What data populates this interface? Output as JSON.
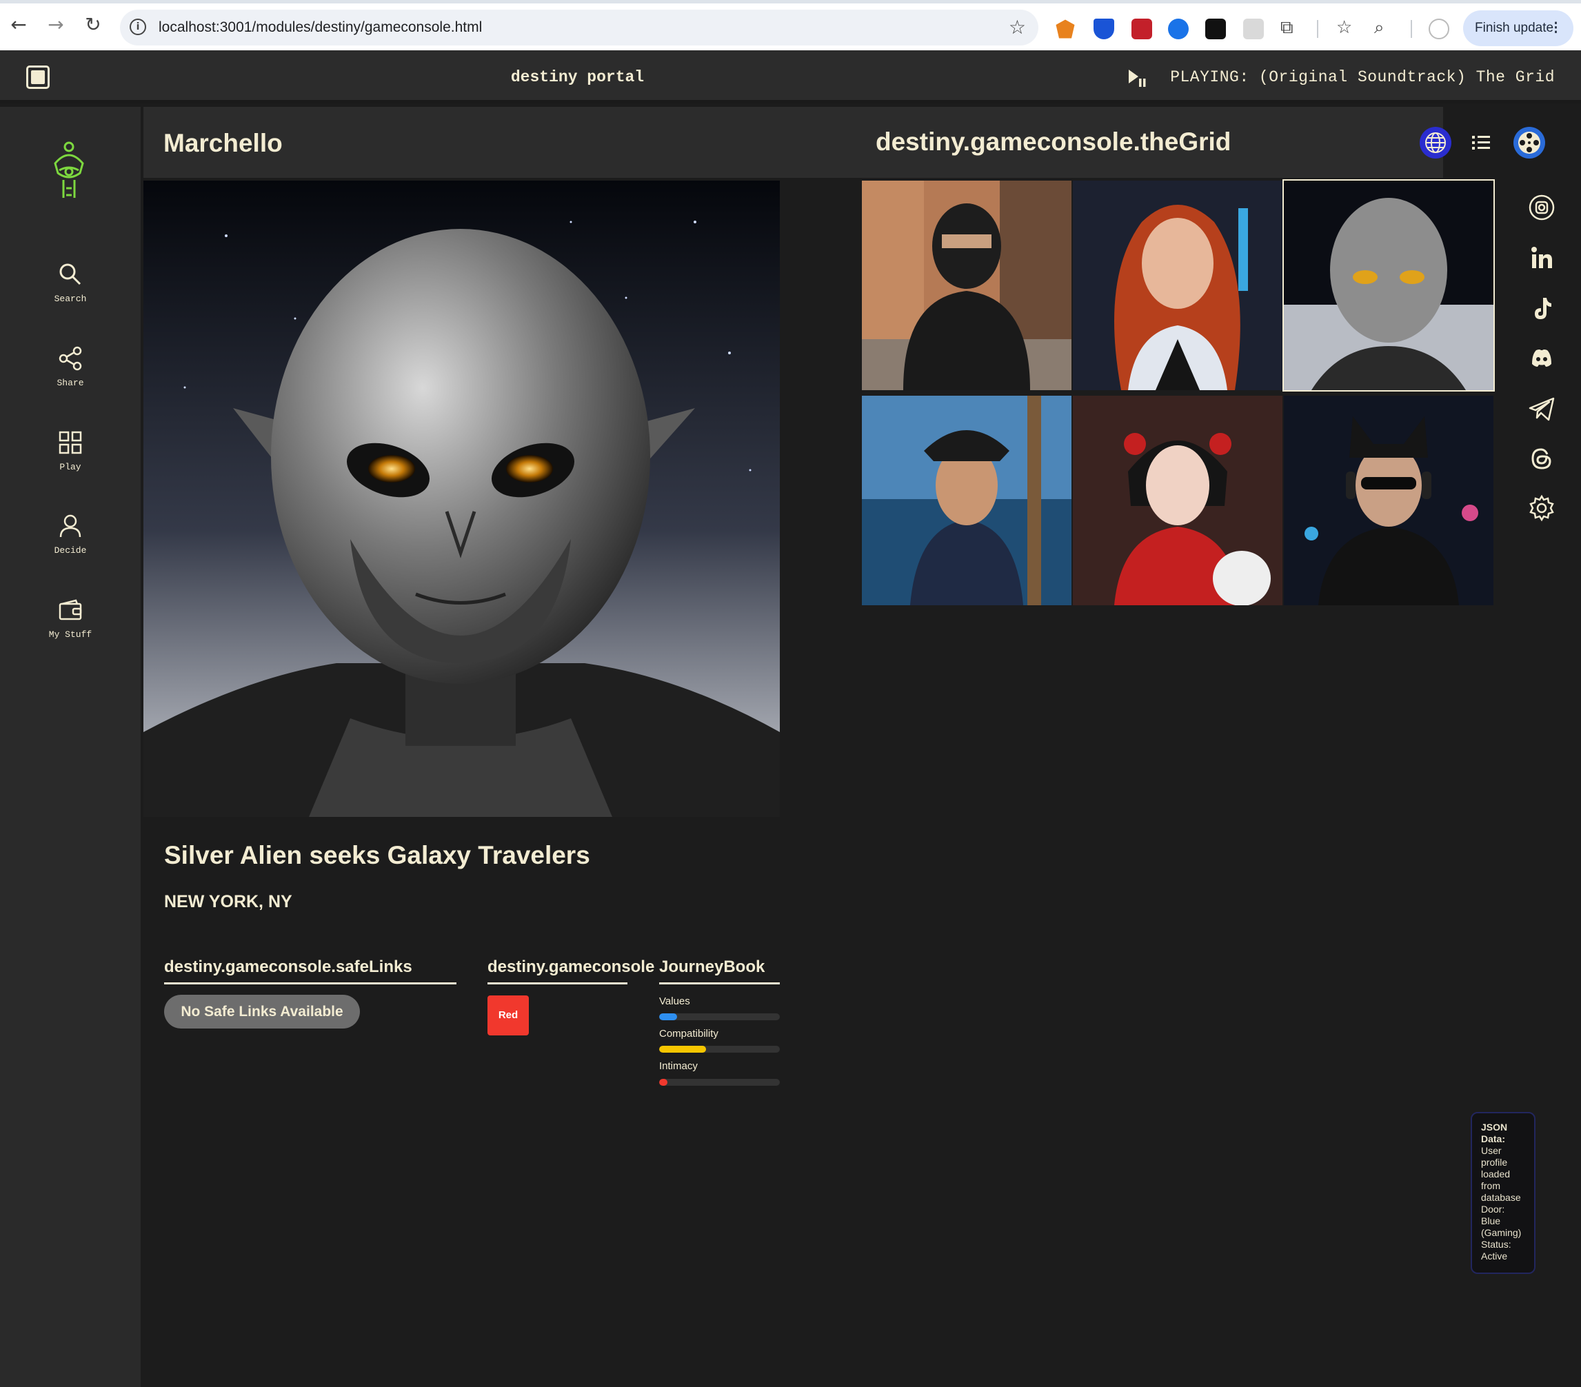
{
  "browser": {
    "url": "localhost:3001/modules/destiny/gameconsole.html",
    "update_button": "Finish update"
  },
  "topbar": {
    "title": "destiny portal",
    "now_playing": "PLAYING: (Original Soundtrack) The Grid"
  },
  "sidebar": {
    "items": [
      {
        "label": "Search",
        "icon": "search-icon"
      },
      {
        "label": "Share",
        "icon": "share-icon"
      },
      {
        "label": "Play",
        "icon": "grid-icon"
      },
      {
        "label": "Decide",
        "icon": "user-icon"
      },
      {
        "label": "My Stuff",
        "icon": "wallet-icon"
      }
    ]
  },
  "header": {
    "profile_name": "Marchello",
    "grid_title": "destiny.gameconsole.theGrid"
  },
  "profile": {
    "headline": "Silver Alien seeks Galaxy Travelers",
    "location": "NEW YORK, NY"
  },
  "safe_links": {
    "title": "destiny.gameconsole.safeLinks",
    "empty_label": "No Safe Links Available"
  },
  "journey": {
    "title": "destiny.gameconsole JourneyBook",
    "door_label": "Red",
    "door_color": "#f1382d",
    "meters": [
      {
        "label": "Values",
        "value": 0.15,
        "color": "#2e8ff0"
      },
      {
        "label": "Compatibility",
        "value": 0.39,
        "color": "#f7c600"
      },
      {
        "label": "Intimacy",
        "value": 0.07,
        "color": "#f1382d"
      }
    ]
  },
  "grid": {
    "tiles": [
      {
        "name": "ninja",
        "selected": false
      },
      {
        "name": "redhead",
        "selected": false
      },
      {
        "name": "silver-alien",
        "selected": true
      },
      {
        "name": "pirate",
        "selected": false
      },
      {
        "name": "geisha-with-cat",
        "selected": false
      },
      {
        "name": "cat-ear-dj",
        "selected": false
      }
    ]
  },
  "social": [
    "instagram-icon",
    "linkedin-icon",
    "tiktok-icon",
    "discord-icon",
    "telegram-icon",
    "threads-icon",
    "settings-icon"
  ],
  "json_status": {
    "heading": "JSON Data:",
    "line1": "User profile loaded from database",
    "line2": "Door: Blue (Gaming)",
    "line3": "Status: Active"
  }
}
